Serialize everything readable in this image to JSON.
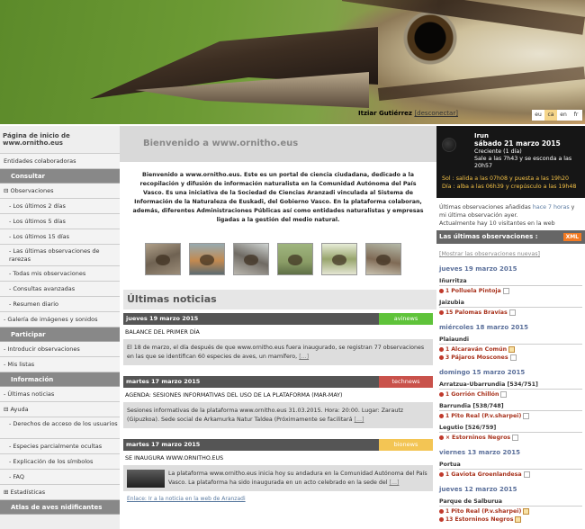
{
  "header": {
    "user_name": "Itziar Gutiérrez",
    "logout_link": "[desconectar]",
    "languages": [
      {
        "code": "eu",
        "selected": false
      },
      {
        "code": "ca",
        "selected": true
      },
      {
        "code": "en",
        "selected": false
      },
      {
        "code": "fr",
        "selected": false
      }
    ]
  },
  "sidebar": {
    "home": "Página de inicio de www.ornitho.eus",
    "items": [
      {
        "label": "Entidades colaboradoras",
        "type": "item"
      },
      {
        "label": "Consultar",
        "type": "section"
      },
      {
        "label": "⊟ Observaciones",
        "type": "item"
      },
      {
        "label": "- Los últimos 2 días",
        "type": "sub"
      },
      {
        "label": "- Los últimos 5 días",
        "type": "sub"
      },
      {
        "label": "- Los últimos 15 días",
        "type": "sub"
      },
      {
        "label": "- Las últimas observaciones de rarezas",
        "type": "sub-two"
      },
      {
        "label": "- Todas mis observaciones",
        "type": "sub"
      },
      {
        "label": "- Consultas avanzadas",
        "type": "sub"
      },
      {
        "label": "- Resumen diario",
        "type": "sub"
      },
      {
        "label": "- Galería de imágenes y sonidos",
        "type": "item"
      },
      {
        "label": "Participar",
        "type": "section"
      },
      {
        "label": "- Introducir observaciones",
        "type": "item"
      },
      {
        "label": "- Mis listas",
        "type": "item"
      },
      {
        "label": "Información",
        "type": "section"
      },
      {
        "label": "- Últimas noticias",
        "type": "item"
      },
      {
        "label": "⊟ Ayuda",
        "type": "item"
      },
      {
        "label": "- Derechos de acceso de los usuarios",
        "type": "sub-two"
      },
      {
        "label": "- Especies parcialmente ocultas",
        "type": "sub"
      },
      {
        "label": "- Explicación de los símbolos",
        "type": "sub"
      },
      {
        "label": "- FAQ",
        "type": "sub"
      },
      {
        "label": "⊞ Estadísticas",
        "type": "item"
      },
      {
        "label": "Atlas de aves nidificantes",
        "type": "section"
      }
    ]
  },
  "main": {
    "welcome_title": "Bienvenido a www.ornitho.eus",
    "intro": "Bienvenido a www.ornitho.eus. Este es un portal de ciencia ciudadana, dedicado a la recopilación y difusión de información naturalista en la Comunidad Autónoma del País Vasco. Es una iniciativa de la Sociedad de Ciencias Aranzadi vinculada al Sistema de Información de la Naturaleza de Euskadi, del Gobierno Vasco. En la plataforma colaboran, además, diferentes Administraciones Públicas así como entidades naturalistas y empresas ligadas a la gestión del medio natural.",
    "news_heading": "Últimas noticias",
    "news": [
      {
        "date": "jueves 19 marzo 2015",
        "tag": "avinews",
        "tag_color": "#5fc33a",
        "title": "BALANCE DEL PRIMER DÍA",
        "body": "El 18 de marzo, el día después de que www.ornitho.eus fuera inaugurado, se registran 77 observaciones en las que se identifican 60 especies de aves, un mamífero,",
        "more": "[...]"
      },
      {
        "date": "martes 17 marzo 2015",
        "tag": "technews",
        "tag_color": "#c9524b",
        "title": "AGENDA: SESIONES INFORMATIVAS DEL USO DE LA PLATAFORMA (MAR-MAY)",
        "body": "Sesiones informativas de la plataforma www.ornitho.eus 31.03.2015. Hora: 20:00. Lugar: Zarautz (Gipuzkoa). Sede social de Arkamurka Natur Taldea (Próximamente se facilitará",
        "more": "[...]"
      },
      {
        "date": "martes 17 marzo 2015",
        "tag": "bionews",
        "tag_color": "#f3c554",
        "title": "SE INAUGURA WWW.ORNITHO.EUS",
        "body": "La plataforma www.ornitho.eus inicia hoy su andadura en la Comunidad Autónoma del País Vasco. La plataforma ha sido inaugurada en un acto celebrado en la sede del",
        "more": "[...]",
        "link": "Enlace: Ir a la noticia en la web de Aranzadi"
      }
    ]
  },
  "right": {
    "place": "Irun",
    "date": "sábado 21 marzo 2015",
    "moon": "Creciente (1 día)",
    "moon_times": "Sale a las 7h43 y se esconda a las 20h57",
    "sun1": "Sol : salida a las 07h08 y puesta a las 19h20",
    "sun2": "Día : alba a las 06h39 y crepúsculo a las 19h48",
    "summary_pre": "Últimas observaciones añadidas ",
    "summary_link": "hace 7 horas",
    "summary_mid": " y mi última observación ayer.",
    "summary_visitors": "Actualmente hay 10 visitantes en la web",
    "last_obs_title": "Las últimas observaciones :",
    "xml_label": "XML",
    "show_link": "[Mostrar las observaciones nuevas]",
    "groups": [
      {
        "day": "jueves 19 marzo 2015",
        "locations": [
          {
            "place": "Iñurritza",
            "obs": [
              {
                "count": "1",
                "species": "Polluela Pintoja",
                "icon": "box"
              }
            ]
          },
          {
            "place": "Jaizubia",
            "obs": [
              {
                "count": "15",
                "species": "Palomas Bravías",
                "icon": "box"
              }
            ]
          }
        ]
      },
      {
        "day": "miércoles 18 marzo 2015",
        "locations": [
          {
            "place": "Plaiaundi",
            "obs": [
              {
                "count": "1",
                "species": "Alcaraván Común",
                "icon": "pen"
              },
              {
                "count": "3",
                "species": "Pájaros Moscones",
                "icon": "box"
              }
            ]
          }
        ]
      },
      {
        "day": "domingo 15 marzo 2015",
        "locations": [
          {
            "place": "Arratzua-Ubarrundia [534/751]",
            "obs": [
              {
                "count": "1",
                "species": "Gorrión Chillón",
                "icon": "box"
              }
            ]
          },
          {
            "place": "Barrundia [538/748]",
            "obs": [
              {
                "count": "1",
                "species": "Pito Real (P.v.sharpei)",
                "icon": "box"
              }
            ]
          },
          {
            "place": "Legutio [526/759]",
            "obs": [
              {
                "count": "×",
                "species": "Estorninos Negros",
                "icon": "box"
              }
            ]
          }
        ]
      },
      {
        "day": "viernes 13 marzo 2015",
        "locations": [
          {
            "place": "Portua",
            "obs": [
              {
                "count": "1",
                "species": "Gaviota Groenlandesa",
                "icon": "box"
              }
            ]
          }
        ]
      },
      {
        "day": "jueves 12 marzo 2015",
        "locations": [
          {
            "place": "Parque de Salburua",
            "obs": [
              {
                "count": "1",
                "species": "Pito Real (P.v.sharpei)",
                "icon": "pen"
              },
              {
                "count": "13",
                "species": "Estorninos Negros",
                "icon": "pen"
              }
            ]
          }
        ]
      }
    ]
  }
}
